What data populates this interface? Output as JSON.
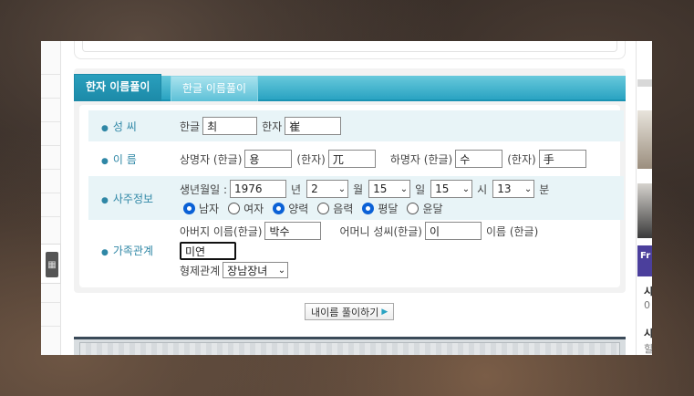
{
  "tabs": [
    {
      "label": "한자 이름풀이",
      "active": true
    },
    {
      "label": "한글 이름풀이",
      "active": false
    }
  ],
  "rows": {
    "surname": {
      "label": "성 씨",
      "hangul_label": "한글",
      "hangul_value": "최",
      "hanja_label": "한자",
      "hanja_value": "崔"
    },
    "name": {
      "label": "이 름",
      "upper_label": "상명자 (한글)",
      "upper_hangul": "용",
      "upper_hanja_label": "(한자)",
      "upper_hanja": "兀",
      "lower_label": "하명자 (한글)",
      "lower_hangul": "수",
      "lower_hanja_label": "(한자)",
      "lower_hanja": "手"
    },
    "saju": {
      "label": "사주정보",
      "birth_label": "생년월일 :",
      "year": "1976",
      "year_unit": "년",
      "month": "2",
      "month_unit": "월",
      "day": "15",
      "day_unit": "일",
      "hour": "15",
      "hour_unit": "시",
      "minute": "13",
      "minute_unit": "분",
      "radios": [
        {
          "label": "남자",
          "checked": true
        },
        {
          "label": "여자",
          "checked": false
        },
        {
          "label": "양력",
          "checked": true
        },
        {
          "label": "음력",
          "checked": false
        },
        {
          "label": "평달",
          "checked": true
        },
        {
          "label": "윤달",
          "checked": false
        }
      ]
    },
    "family": {
      "label": "가족관계",
      "father_label": "아버지 이름(한글)",
      "father_value": "박수",
      "mother_label": "어머니 성씨(한글)",
      "mother_value": "이",
      "mother_name_label": "이름 (한글)",
      "mother_name_value": "미연",
      "sibling_label": "형제관계",
      "sibling_value": "장남장녀"
    }
  },
  "submit_label": "내이름 풀이하기",
  "right_col": {
    "banner_text": "Fr",
    "texts": [
      "시",
      "시"
    ],
    "sub_texts": [
      "0",
      "힐"
    ]
  },
  "colors": {
    "tab_active": "#1c8aa8",
    "tab_bar": "#2aa3c2",
    "label": "#2f87a6",
    "row_shade": "#e8f4f7",
    "radio_on": "#0b61d6"
  }
}
